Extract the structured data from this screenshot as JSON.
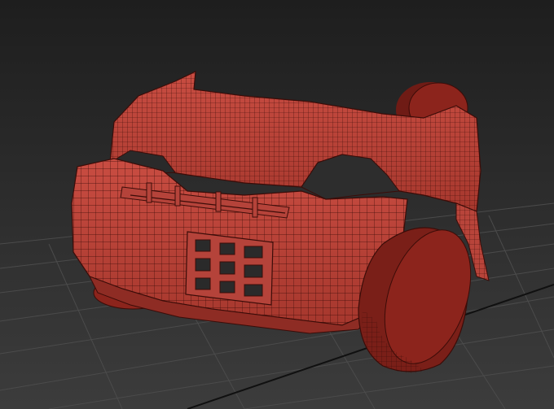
{
  "viewport": {
    "background_top": "#1f1f1f",
    "background_bottom": "#3a3a3a",
    "grid_color": "#4a4a4a",
    "grid_dark_color": "#121212",
    "model_fill": "#c0473d",
    "model_shadow": "#8a2a22",
    "model_wire": "#3a0d09",
    "wheel_fill": "#7a1f18",
    "wheel_face": "#8c241c"
  }
}
